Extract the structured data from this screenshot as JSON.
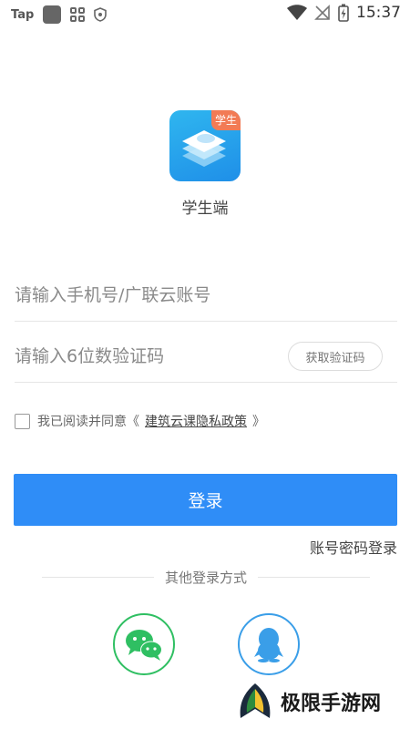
{
  "status_bar": {
    "app_label": "Tap",
    "time": "15:37",
    "icons": [
      "app-square-icon",
      "grid-icon",
      "shield-icon",
      "wifi-icon",
      "signal-off-icon",
      "battery-icon"
    ]
  },
  "app": {
    "badge": "学生",
    "name": "学生端"
  },
  "form": {
    "phone_placeholder": "请输入手机号/广联云账号",
    "code_placeholder": "请输入6位数验证码",
    "get_code_label": "获取验证码"
  },
  "agreement": {
    "prefix": "我已阅读并同意《",
    "link": "建筑云课隐私政策",
    "suffix": "》"
  },
  "login_label": "登录",
  "password_login_label": "账号密码登录",
  "other_login": {
    "label": "其他登录方式",
    "methods": [
      "wechat-icon",
      "qq-icon"
    ]
  },
  "watermark": {
    "text": "极限手游网"
  },
  "colors": {
    "primary": "#2f8df7",
    "wechat": "#2fbf62",
    "qq": "#3a9ee8",
    "badge": "#f27b55"
  }
}
